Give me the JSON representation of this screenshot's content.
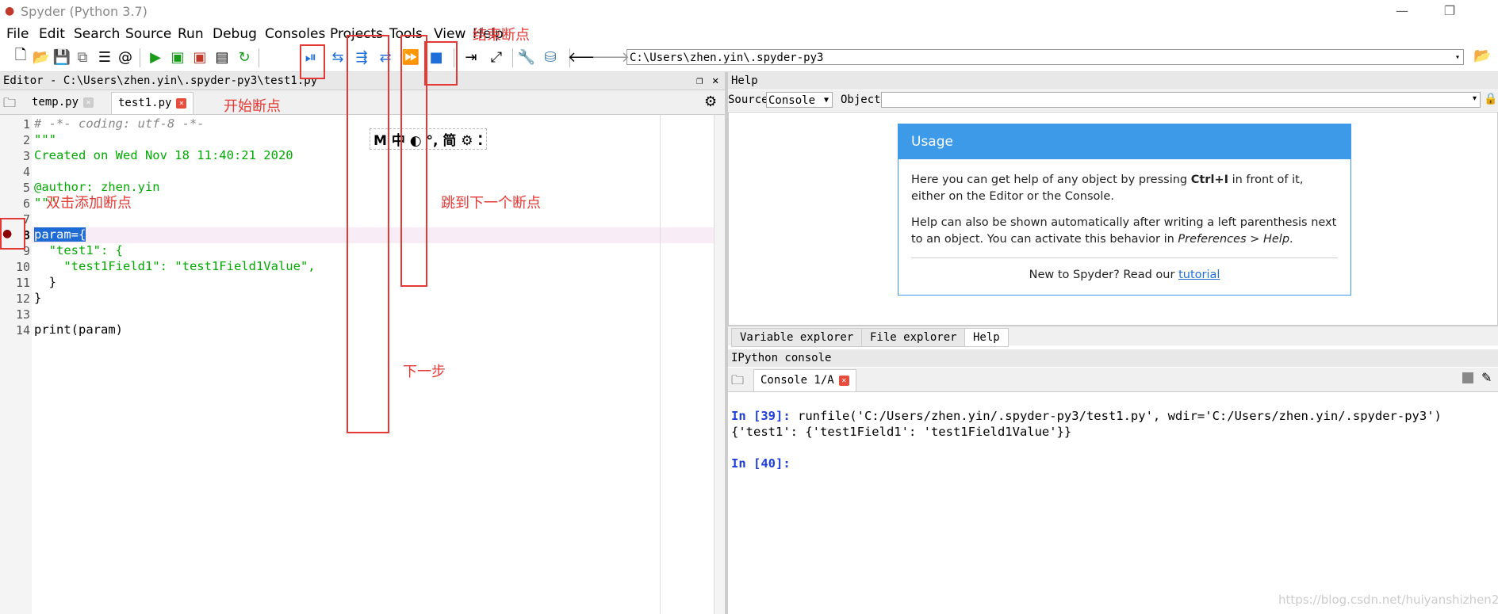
{
  "window": {
    "title": "Spyder (Python 3.7)",
    "min": "—",
    "restore": "❐"
  },
  "menu": [
    "File",
    "Edit",
    "Search",
    "Source",
    "Run",
    "Debug",
    "Consoles",
    "Projects",
    "Tools",
    "View",
    "Help"
  ],
  "toolbar": {
    "path": "C:\\Users\\zhen.yin\\.spyder-py3"
  },
  "editor": {
    "header": "Editor - C:\\Users\\zhen.yin\\.spyder-py3\\test1.py",
    "tabs": [
      {
        "label": "temp.py"
      },
      {
        "label": "test1.py"
      }
    ],
    "lines": [
      {
        "n": "1",
        "text": "# -*- coding: utf-8 -*-"
      },
      {
        "n": "2",
        "text": "\"\"\""
      },
      {
        "n": "3",
        "text": "Created on Wed Nov 18 11:40:21 2020"
      },
      {
        "n": "4",
        "text": ""
      },
      {
        "n": "5",
        "text": "@author: zhen.yin"
      },
      {
        "n": "6",
        "text": "\"\"\""
      },
      {
        "n": "7",
        "text": ""
      },
      {
        "n": "8",
        "text": "param={"
      },
      {
        "n": "9",
        "text": "  \"test1\": {"
      },
      {
        "n": "10",
        "text": "    \"test1Field1\": \"test1Field1Value\","
      },
      {
        "n": "11",
        "text": "  }"
      },
      {
        "n": "12",
        "text": "}"
      },
      {
        "n": "13",
        "text": ""
      },
      {
        "n": "14",
        "text": "print(param)"
      }
    ],
    "breakpoint_line": "8",
    "ime_bar": "M 中 ◐ °, 简 ⚙ ⁚"
  },
  "help": {
    "header": "Help",
    "source_label": "Source",
    "source_value": "Console",
    "object_label": "Object",
    "usage_title": "Usage",
    "p1a": "Here you can get help of any object by pressing ",
    "p1b": "Ctrl+I",
    "p1c": " in front of it, either on the Editor or the Console.",
    "p2a": "Help can also be shown automatically after writing a left parenthesis next to an object. You can activate this behavior in ",
    "p2b": "Preferences > Help",
    "p2c": ".",
    "new_a": "New to Spyder? Read our ",
    "new_link": "tutorial",
    "tabs": [
      "Variable explorer",
      "File explorer",
      "Help"
    ]
  },
  "ipython": {
    "header": "IPython console",
    "tab": "Console 1/A",
    "in39_prompt": "In [39]:",
    "in39_cmd": " runfile('C:/Users/zhen.yin/.spyder-py3/test1.py', wdir='C:/Users/zhen.yin/.spyder-py3')",
    "out": "{'test1': {'test1Field1': 'test1Field1Value'}}",
    "in40_prompt": "In [40]:"
  },
  "annotations": {
    "end": "结束断点",
    "start": "开始断点",
    "dblclick": "双击添加断点",
    "next_bp": "跳到下一个断点",
    "step": "下一步"
  },
  "watermark": "https://blog.csdn.net/huiyanshizhen21",
  "colors": {
    "accent": "#3d9ae8",
    "annotation": "#e53935",
    "string": "#00aa00",
    "comment": "#888888",
    "keyword": "#0000cc"
  }
}
